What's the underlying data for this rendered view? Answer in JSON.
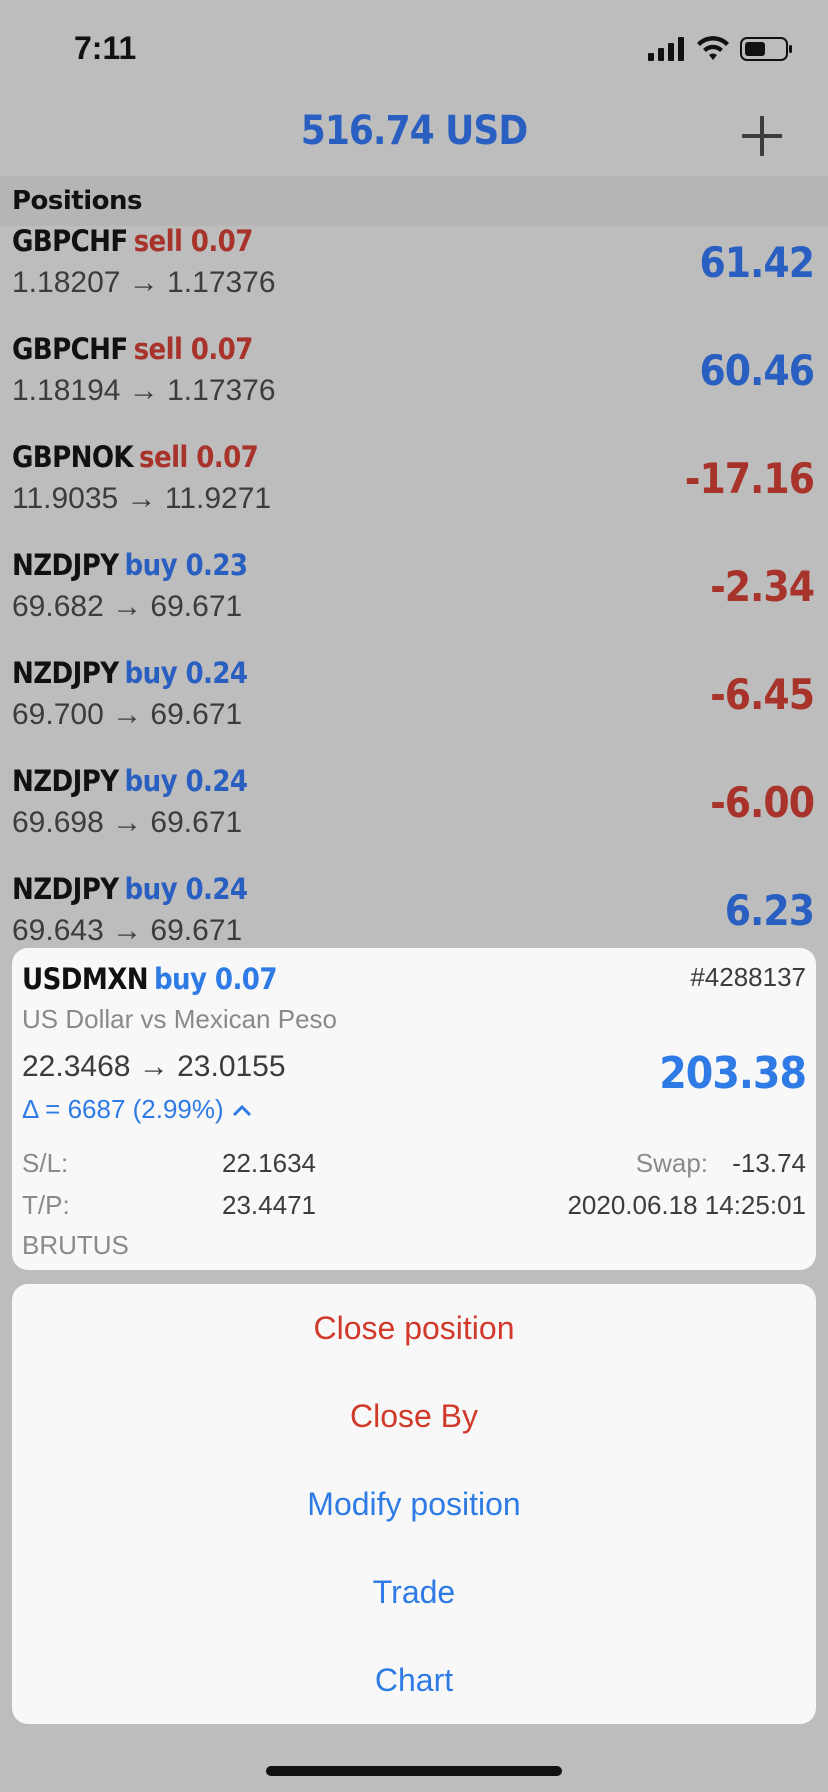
{
  "status": {
    "time": "7:11"
  },
  "header": {
    "balance": "516.74 USD"
  },
  "section": {
    "title": "Positions"
  },
  "positions": [
    {
      "symbol": "GBPCHF",
      "side": "sell 0.07",
      "direction": "sell",
      "prices": "1.18207 → 1.17376",
      "profit": "61.42",
      "sign": "pos"
    },
    {
      "symbol": "GBPCHF",
      "side": "sell 0.07",
      "direction": "sell",
      "prices": "1.18194 → 1.17376",
      "profit": "60.46",
      "sign": "pos"
    },
    {
      "symbol": "GBPNOK",
      "side": "sell 0.07",
      "direction": "sell",
      "prices": "11.9035 → 11.9271",
      "profit": "-17.16",
      "sign": "neg"
    },
    {
      "symbol": "NZDJPY",
      "side": "buy 0.23",
      "direction": "buy",
      "prices": "69.682 → 69.671",
      "profit": "-2.34",
      "sign": "neg"
    },
    {
      "symbol": "NZDJPY",
      "side": "buy 0.24",
      "direction": "buy",
      "prices": "69.700 → 69.671",
      "profit": "-6.45",
      "sign": "neg"
    },
    {
      "symbol": "NZDJPY",
      "side": "buy 0.24",
      "direction": "buy",
      "prices": "69.698 → 69.671",
      "profit": "-6.00",
      "sign": "neg"
    },
    {
      "symbol": "NZDJPY",
      "side": "buy 0.24",
      "direction": "buy",
      "prices": "69.643 → 69.671",
      "profit": "6.23",
      "sign": "pos"
    }
  ],
  "selected": {
    "symbol": "USDMXN",
    "side": "buy 0.07",
    "ticket": "#4288137",
    "description": "US Dollar vs Mexican Peso",
    "prices": "22.3468 → 23.0155",
    "profit": "203.38",
    "delta": "Δ = 6687 (2.99%)",
    "sl_label": "S/L:",
    "sl_value": "22.1634",
    "tp_label": "T/P:",
    "tp_value": "23.4471",
    "swap_label": "Swap:",
    "swap_value": "-13.74",
    "time": "2020.06.18 14:25:01",
    "comment": "BRUTUS"
  },
  "actions": {
    "close_position": "Close position",
    "close_by": "Close By",
    "modify_position": "Modify position",
    "trade": "Trade",
    "chart": "Chart"
  },
  "colors": {
    "blue": "#2a5fc2",
    "red": "#a8332a",
    "action_red": "#d1392b",
    "action_blue": "#2f7be5"
  }
}
